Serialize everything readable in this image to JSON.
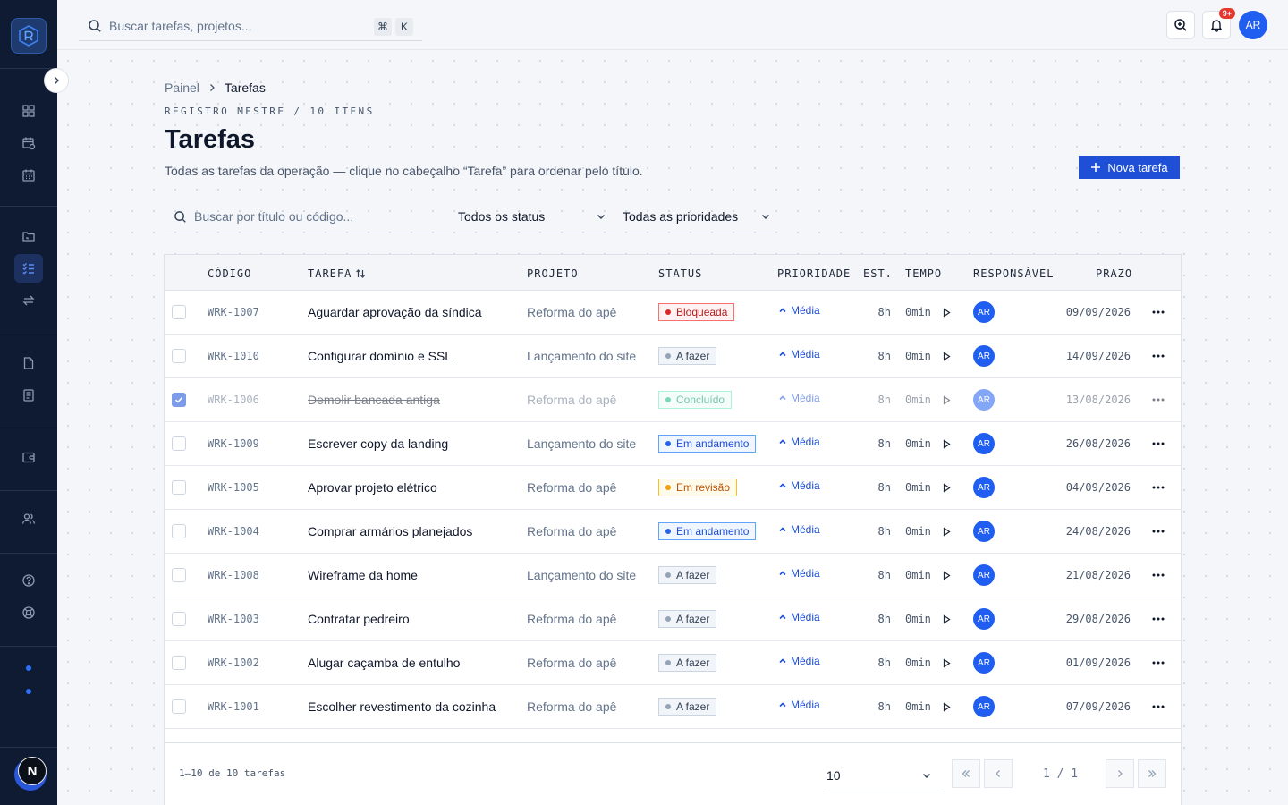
{
  "topbar": {
    "search_placeholder": "Buscar tarefas, projetos...",
    "kbd_cmd": "⌘",
    "kbd_key": "K",
    "notifications_badge": "9+",
    "user_initials": "AR"
  },
  "sidebar": {
    "user_initial": "N"
  },
  "breadcrumb": {
    "parent": "Painel",
    "current": "Tarefas"
  },
  "page": {
    "eyebrow": "REGISTRO MESTRE / 10 ITENS",
    "title": "Tarefas",
    "subtitle": "Todas as tarefas da operação — clique no cabeçalho “Tarefa” para ordenar pelo título.",
    "new_button": "Nova tarefa"
  },
  "filters": {
    "search_placeholder": "Buscar por título ou código...",
    "status": "Todos os status",
    "priority": "Todas as prioridades"
  },
  "table": {
    "headers": {
      "code": "CÓDIGO",
      "task": "TAREFA",
      "project": "PROJETO",
      "status": "STATUS",
      "priority": "PRIORIDADE",
      "est": "EST.",
      "time": "TEMPO",
      "assignee": "RESPONSÁVEL",
      "due": "PRAZO"
    },
    "rows": [
      {
        "code": "WRK-1007",
        "task": "Aguardar aprovação da síndica",
        "project": "Reforma do apê",
        "status": "Bloqueada",
        "priority": "Média",
        "est": "8h",
        "time": "0min",
        "assignee": "AR",
        "due": "09/09/2026",
        "checked": false
      },
      {
        "code": "WRK-1010",
        "task": "Configurar domínio e SSL",
        "project": "Lançamento do site",
        "status": "A fazer",
        "priority": "Média",
        "est": "8h",
        "time": "0min",
        "assignee": "AR",
        "due": "14/09/2026",
        "checked": false
      },
      {
        "code": "WRK-1006",
        "task": "Demolir bancada antiga",
        "project": "Reforma do apê",
        "status": "Concluído",
        "priority": "Média",
        "est": "8h",
        "time": "0min",
        "assignee": "AR",
        "due": "13/08/2026",
        "checked": true
      },
      {
        "code": "WRK-1009",
        "task": "Escrever copy da landing",
        "project": "Lançamento do site",
        "status": "Em andamento",
        "priority": "Média",
        "est": "8h",
        "time": "0min",
        "assignee": "AR",
        "due": "26/08/2026",
        "checked": false
      },
      {
        "code": "WRK-1005",
        "task": "Aprovar projeto elétrico",
        "project": "Reforma do apê",
        "status": "Em revisão",
        "priority": "Média",
        "est": "8h",
        "time": "0min",
        "assignee": "AR",
        "due": "04/09/2026",
        "checked": false
      },
      {
        "code": "WRK-1004",
        "task": "Comprar armários planejados",
        "project": "Reforma do apê",
        "status": "Em andamento",
        "priority": "Média",
        "est": "8h",
        "time": "0min",
        "assignee": "AR",
        "due": "24/08/2026",
        "checked": false
      },
      {
        "code": "WRK-1008",
        "task": "Wireframe da home",
        "project": "Lançamento do site",
        "status": "A fazer",
        "priority": "Média",
        "est": "8h",
        "time": "0min",
        "assignee": "AR",
        "due": "21/08/2026",
        "checked": false
      },
      {
        "code": "WRK-1003",
        "task": "Contratar pedreiro",
        "project": "Reforma do apê",
        "status": "A fazer",
        "priority": "Média",
        "est": "8h",
        "time": "0min",
        "assignee": "AR",
        "due": "29/08/2026",
        "checked": false
      },
      {
        "code": "WRK-1002",
        "task": "Alugar caçamba de entulho",
        "project": "Reforma do apê",
        "status": "A fazer",
        "priority": "Média",
        "est": "8h",
        "time": "0min",
        "assignee": "AR",
        "due": "01/09/2026",
        "checked": false
      },
      {
        "code": "WRK-1001",
        "task": "Escolher revestimento da cozinha",
        "project": "Reforma do apê",
        "status": "A fazer",
        "priority": "Média",
        "est": "8h",
        "time": "0min",
        "assignee": "AR",
        "due": "07/09/2026",
        "checked": false
      }
    ]
  },
  "status_styles": {
    "Bloqueada": {
      "bg": "#fef2f2",
      "border": "#f87171",
      "color": "#b91c1c",
      "dot": "#dc2626"
    },
    "A fazer": {
      "bg": "#f1f5f9",
      "border": "#cbd5e1",
      "color": "#334155",
      "dot": "#94a3b8"
    },
    "Concluído": {
      "bg": "#ecfdf5",
      "border": "#6ee7b7",
      "color": "#059669",
      "dot": "#10b981"
    },
    "Em andamento": {
      "bg": "#eff6ff",
      "border": "#60a5fa",
      "color": "#1d4ed8",
      "dot": "#2563eb"
    },
    "Em revisão": {
      "bg": "#fffbeb",
      "border": "#fbbf24",
      "color": "#b45309",
      "dot": "#f59e0b"
    }
  },
  "pagination": {
    "summary": "1–10 de 10 tarefas",
    "page_size": "10",
    "page_indicator": "1 / 1"
  },
  "colors": {
    "accent": "#1e4fd6",
    "sidebar_bg": "#0f1a33"
  }
}
